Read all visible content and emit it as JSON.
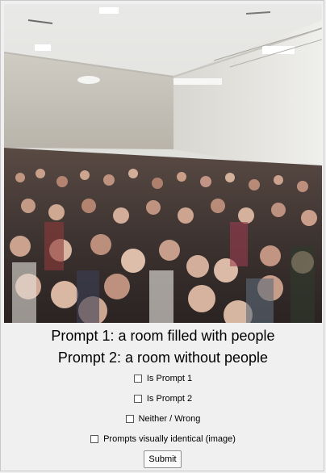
{
  "prompts": {
    "prompt1": "Prompt 1: a room filled with people",
    "prompt2": "Prompt 2: a room without people"
  },
  "options": [
    {
      "label": "Is Prompt 1",
      "checked": false
    },
    {
      "label": "Is Prompt 2",
      "checked": false
    },
    {
      "label": "Neither / Wrong",
      "checked": false
    },
    {
      "label": "Prompts visually identical (image)",
      "checked": false
    }
  ],
  "submit_label": "Submit",
  "image": {
    "subject": "crowded-room-photo"
  }
}
